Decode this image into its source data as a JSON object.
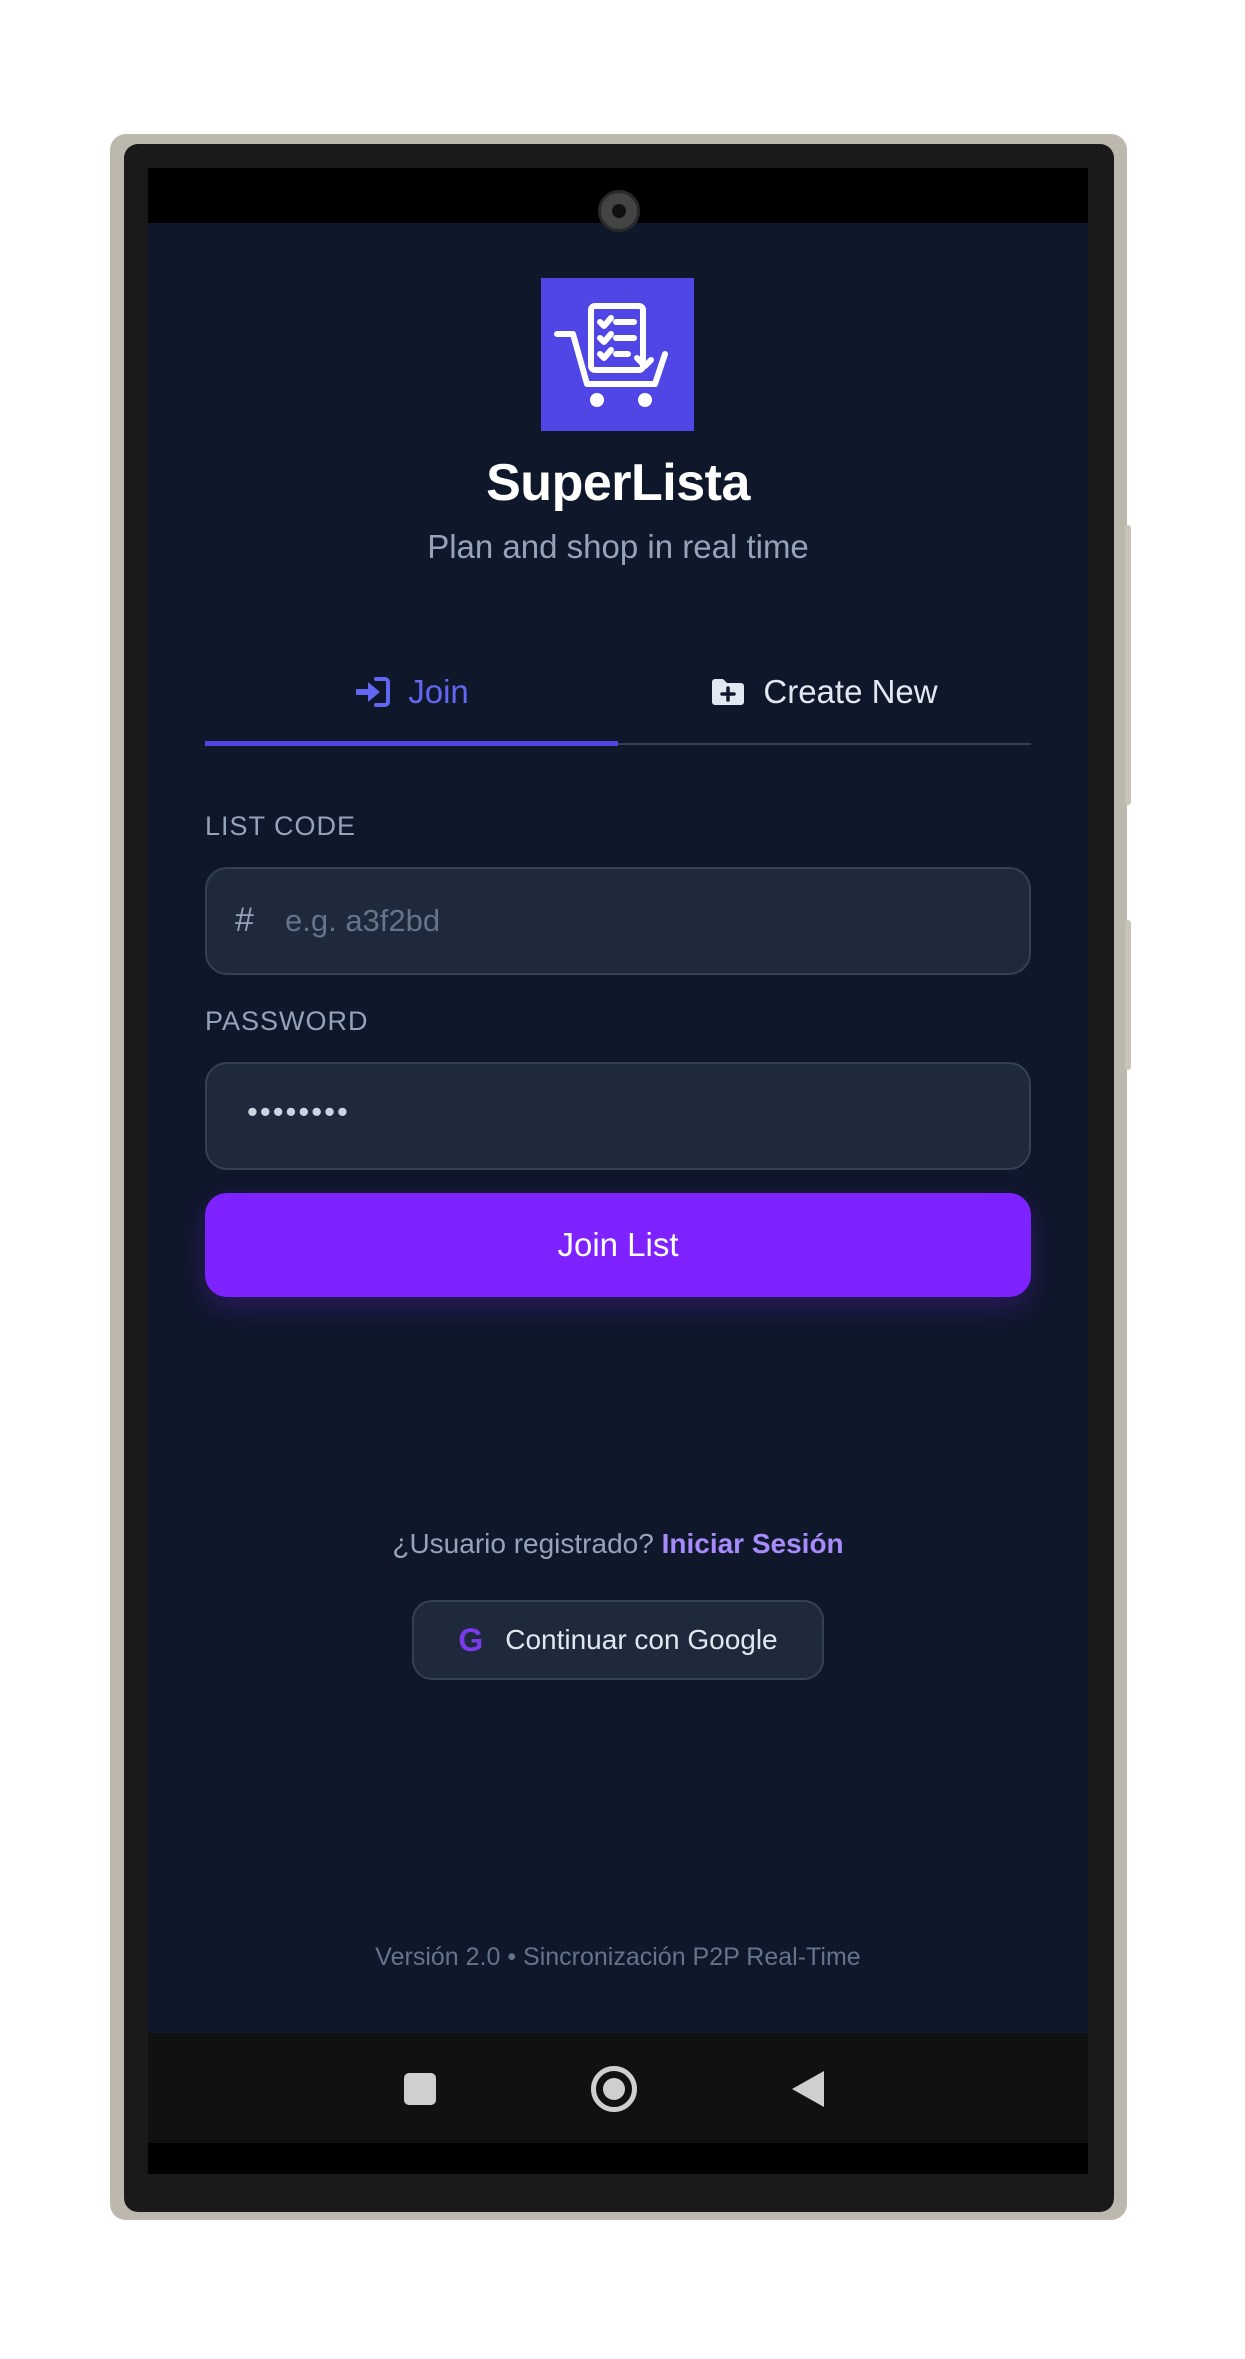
{
  "app": {
    "title": "SuperLista",
    "subtitle": "Plan and shop in real time",
    "logo_icon": "shopping-cart-checklist-icon",
    "accent": "#4f46e5",
    "background": "#0f172a"
  },
  "tabs": [
    {
      "label": "Join",
      "icon": "sign-in-icon",
      "active": true
    },
    {
      "label": "Create New",
      "icon": "folder-plus-icon",
      "active": false
    }
  ],
  "form": {
    "list_code_label": "LIST CODE",
    "list_code_prefix": "#",
    "list_code_placeholder": "e.g. a3f2bd",
    "password_label": "PASSWORD",
    "password_value": "••••••••",
    "submit_label": "Join List",
    "submit_color": "#7e22ff"
  },
  "auth": {
    "registered_prompt": "¿Usuario registrado?",
    "login_link": "Iniciar Sesión",
    "google_label": "Continuar con Google",
    "google_icon": "G"
  },
  "footer": {
    "version": "Versión 2.0 • Sincronización P2P Real-Time"
  },
  "system_nav": {
    "items": [
      "recents-icon",
      "home-icon",
      "back-icon"
    ]
  }
}
